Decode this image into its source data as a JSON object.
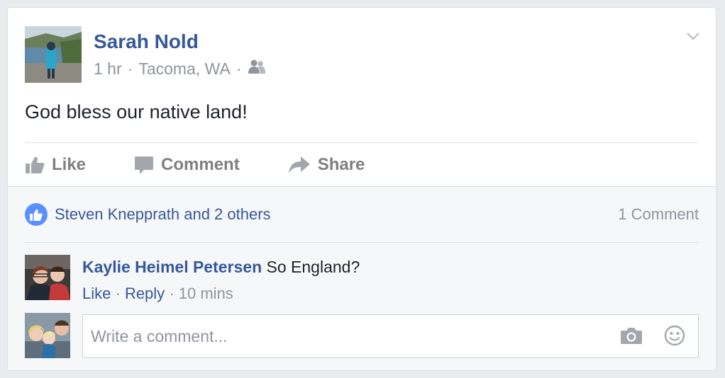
{
  "post": {
    "author": "Sarah Nold",
    "time": "1 hr",
    "location": "Tacoma, WA",
    "audience_icon": "friends-icon",
    "text": "God bless our native land!"
  },
  "actions": {
    "like_label": "Like",
    "comment_label": "Comment",
    "share_label": "Share"
  },
  "reactions": {
    "likers_text": "Steven Knepprath and 2 others",
    "comment_count": "1 Comment"
  },
  "comments": [
    {
      "author": "Kaylie Heimel Petersen",
      "text": "So England?",
      "like_label": "Like",
      "reply_label": "Reply",
      "time": "10 mins"
    }
  ],
  "composer": {
    "placeholder": "Write a comment...",
    "camera_icon": "camera-icon",
    "emoji_icon": "smiley-icon"
  },
  "colors": {
    "link": "#365899",
    "muted": "#90949c",
    "like_blue": "#5890ff",
    "background": "#e9ebee"
  }
}
